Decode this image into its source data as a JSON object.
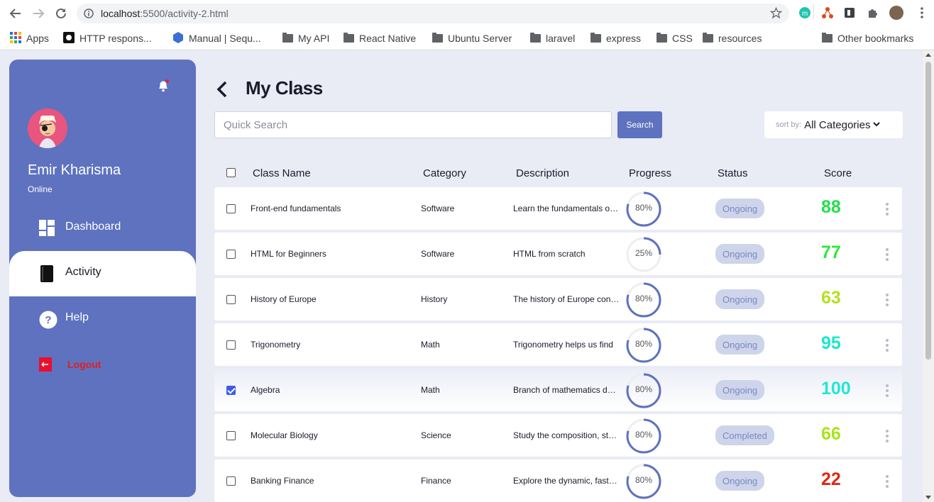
{
  "browser": {
    "url_host": "localhost",
    "url_path": ":5500/activity-2.html",
    "bookmarks": [
      {
        "label": "Apps",
        "icon": "apps-grid-icon"
      },
      {
        "label": "HTTP respons...",
        "icon": "github-icon"
      },
      {
        "label": "Manual | Sequ...",
        "icon": "sequelize-icon"
      },
      {
        "label": "My API",
        "icon": "folder-icon"
      },
      {
        "label": "React Native",
        "icon": "folder-icon"
      },
      {
        "label": "Ubuntu Server",
        "icon": "folder-icon"
      },
      {
        "label": "laravel",
        "icon": "folder-icon"
      },
      {
        "label": "express",
        "icon": "folder-icon"
      },
      {
        "label": "CSS",
        "icon": "folder-icon"
      },
      {
        "label": "resources",
        "icon": "folder-icon"
      }
    ],
    "other_bookmarks": "Other bookmarks"
  },
  "sidebar": {
    "user_name": "Emir Kharisma",
    "user_status": "Online",
    "menu": [
      {
        "label": "Dashboard",
        "icon": "dashboard-icon"
      },
      {
        "label": "Activity",
        "icon": "book-icon"
      },
      {
        "label": "Help",
        "icon": "help-icon"
      },
      {
        "label": "Logout",
        "icon": "logout-icon"
      }
    ]
  },
  "header": {
    "title": "My Class",
    "search_placeholder": "Quick Search",
    "search_button": "Search",
    "sort_label": "sort by:",
    "sort_value": "All Categories"
  },
  "table": {
    "columns": [
      "Class Name",
      "Category",
      "Description",
      "Progress",
      "Status",
      "Score"
    ],
    "rows": [
      {
        "name": "Front-end fundamentals",
        "category": "Software",
        "description": "Learn the fundamentals of front-end",
        "progress": 80,
        "progress_label": "80%",
        "status": "Ongoing",
        "score": "88",
        "score_color": "#22e04a",
        "checked": false
      },
      {
        "name": "HTML for Beginners",
        "category": "Software",
        "description": "HTML from scratch",
        "progress": 25,
        "progress_label": "25%",
        "status": "Ongoing",
        "score": "77",
        "score_color": "#2ee83c",
        "checked": false
      },
      {
        "name": "History of Europe",
        "category": "History",
        "description": "The history of Europe concerns",
        "progress": 80,
        "progress_label": "80%",
        "status": "Ongoing",
        "score": "63",
        "score_color": "#b4e020",
        "checked": false
      },
      {
        "name": "Trigonometry",
        "category": "Math",
        "description": "Trigonometry helps us find",
        "progress": 80,
        "progress_label": "80%",
        "status": "Ongoing",
        "score": "95",
        "score_color": "#18e8c8",
        "checked": false
      },
      {
        "name": "Algebra",
        "category": "Math",
        "description": "Branch of mathematics dealing",
        "progress": 80,
        "progress_label": "80%",
        "status": "Ongoing",
        "score": "100",
        "score_color": "#1ee8d8",
        "checked": true
      },
      {
        "name": "Molecular Biology",
        "category": "Science",
        "description": "Study the composition, structure",
        "progress": 80,
        "progress_label": "80%",
        "status": "Completed",
        "score": "66",
        "score_color": "#a8e41c",
        "checked": false
      },
      {
        "name": "Banking Finance",
        "category": "Finance",
        "description": "Explore the dynamic, fast-paced",
        "progress": 80,
        "progress_label": "80%",
        "status": "Ongoing",
        "score": "22",
        "score_color": "#e0280e",
        "checked": false
      }
    ]
  },
  "colors": {
    "primary": "#5e72bf",
    "background": "#e9ebf5",
    "badge_bg": "#ced4ea",
    "progress_ring": "#5e72bf",
    "logout": "#e02020"
  }
}
